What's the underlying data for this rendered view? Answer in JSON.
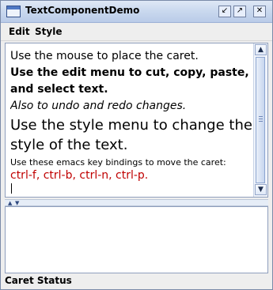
{
  "window": {
    "title": "TextComponentDemo",
    "controls": [
      "resize-icon",
      "maximize-icon",
      "close-icon"
    ]
  },
  "menubar": {
    "items": [
      "Edit",
      "Style"
    ]
  },
  "editor": {
    "lines": [
      "Use the mouse to place the caret.",
      "Use the edit menu to cut, copy, paste,",
      "and select text.",
      "Also to undo and redo changes.",
      "Use the style menu to change the",
      "style of the text.",
      "Use these emacs key bindings to move the caret:",
      "ctrl-f, ctrl-b, ctrl-n, ctrl-p."
    ]
  },
  "lower_panel": {
    "text": ""
  },
  "status": {
    "label": "Caret Status"
  },
  "colors": {
    "title_bar_top": "#dfe8f6",
    "title_bar_bottom": "#b9cbe8",
    "red_text": "#c00000",
    "border": "#8f9fbd"
  }
}
